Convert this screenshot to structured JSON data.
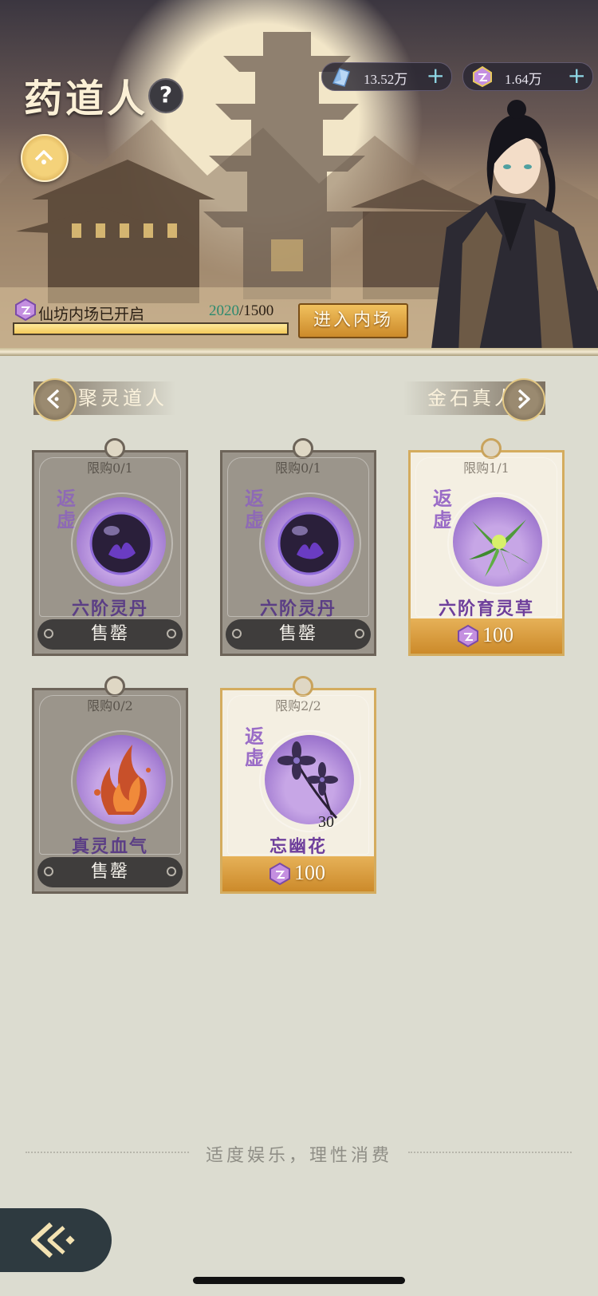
{
  "header": {
    "title": "药道人",
    "help_label": "?",
    "currencies": [
      {
        "icon": "spirit-crystal-icon",
        "amount": "13.52万",
        "plus": "+"
      },
      {
        "icon": "immortal-jade-icon",
        "amount": "1.64万",
        "plus": "+"
      }
    ],
    "progress": {
      "label": "仙坊内场已开启",
      "current": "2020",
      "separator": "/",
      "total": "1500",
      "fill_fraction": 1.0
    },
    "enter_button": "进入内场"
  },
  "nav": {
    "prev_label": "聚灵道人",
    "next_label": "金石真人"
  },
  "cards": [
    {
      "limit": "限购0/1",
      "grade": "返虚",
      "name": "六阶灵丹",
      "status": "售罄",
      "art": "dark-orb-icon",
      "sold_out": true
    },
    {
      "limit": "限购0/1",
      "grade": "返虚",
      "name": "六阶灵丹",
      "status": "售罄",
      "art": "dark-orb-icon",
      "sold_out": true
    },
    {
      "limit": "限购1/1",
      "grade": "返虚",
      "name": "六阶育灵草",
      "price": "100",
      "art": "green-herb-icon",
      "sold_out": false
    },
    {
      "limit": "限购0/2",
      "grade": "",
      "name": "真灵血气",
      "status": "售罄",
      "art": "blood-flame-icon",
      "sold_out": true
    },
    {
      "limit": "限购2/2",
      "grade": "返虚",
      "name": "忘幽花",
      "quantity": "30",
      "price": "100",
      "art": "purple-flower-icon",
      "sold_out": false
    }
  ],
  "footer": {
    "notice": "适度娱乐，理性消费"
  },
  "colors": {
    "accent_gold": "#d4ac5e",
    "grade_purple": "#9a6cc7",
    "progress_current": "#2b8a6e"
  }
}
